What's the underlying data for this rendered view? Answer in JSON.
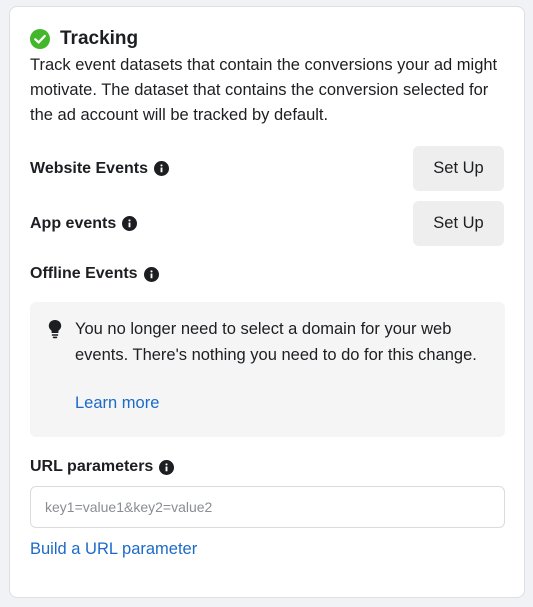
{
  "colors": {
    "accent_green": "#42b72a",
    "link_blue": "#1b6ac9",
    "button_bg": "#eeeeee",
    "notice_bg": "#f5f5f5"
  },
  "tracking": {
    "icon": "check-circle-icon",
    "title": "Tracking",
    "description": "Track event datasets that contain the conversions your ad might motivate. The dataset that contains the conversion selected for the ad account will be tracked by default."
  },
  "events": {
    "website": {
      "label": "Website Events",
      "button": "Set Up"
    },
    "app": {
      "label": "App events",
      "button": "Set Up"
    },
    "offline": {
      "label": "Offline Events"
    }
  },
  "notice": {
    "icon": "lightbulb-icon",
    "text": "You no longer need to select a domain for your web events. There's nothing you need to do for this change.",
    "link": "Learn more"
  },
  "url_parameters": {
    "label": "URL parameters",
    "placeholder": "key1=value1&key2=value2",
    "value": "",
    "build_link": "Build a URL parameter"
  }
}
